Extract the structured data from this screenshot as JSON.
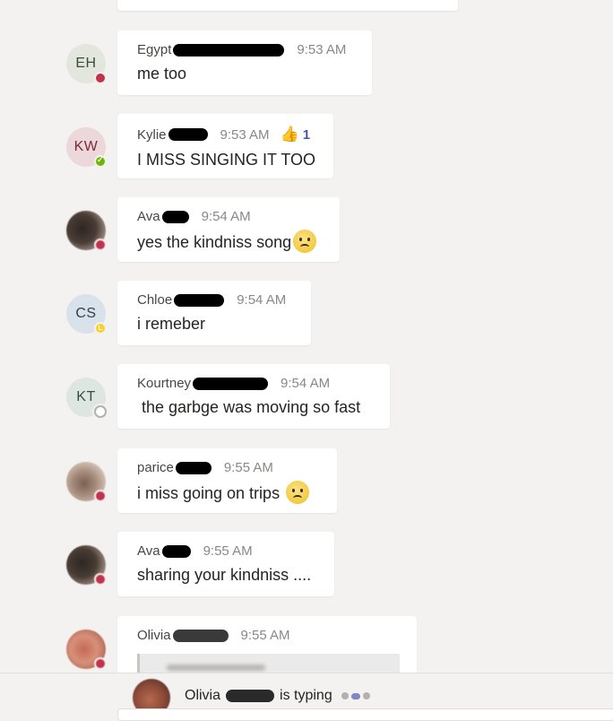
{
  "messages": [
    {
      "initials": "EH",
      "name": "Egypt",
      "time": "9:53 AM",
      "text": "me too"
    },
    {
      "initials": "KW",
      "name": "Kylie",
      "time": "9:53 AM",
      "text": "I MISS SINGING IT TOO",
      "reaction_count": "1"
    },
    {
      "initials": "",
      "name": "Ava",
      "time": "9:54 AM",
      "text": "yes the kindniss song"
    },
    {
      "initials": "CS",
      "name": "Chloe",
      "time": "9:54 AM",
      "text": "i remeber"
    },
    {
      "initials": "KT",
      "name": "Kourtney",
      "time": "9:54 AM",
      "text": " the garbge was moving so fast"
    },
    {
      "initials": "",
      "name": "parice",
      "time": "9:55 AM",
      "text": "i miss going on trips"
    },
    {
      "initials": "",
      "name": "Ava",
      "time": "9:55 AM",
      "text": "sharing your kindniss ...."
    },
    {
      "initials": "",
      "name": "Olivia",
      "time": "9:55 AM",
      "text": ""
    }
  ],
  "typing": {
    "name": "Olivia",
    "suffix": "is typing"
  },
  "colors": {
    "busy": "#c4314b",
    "available": "#6bb700",
    "away": "#f8d22a",
    "accent": "#4f52b2"
  },
  "icons": {
    "reaction": "thumbs-up-icon",
    "sad": "sad-face-emoji-icon"
  }
}
